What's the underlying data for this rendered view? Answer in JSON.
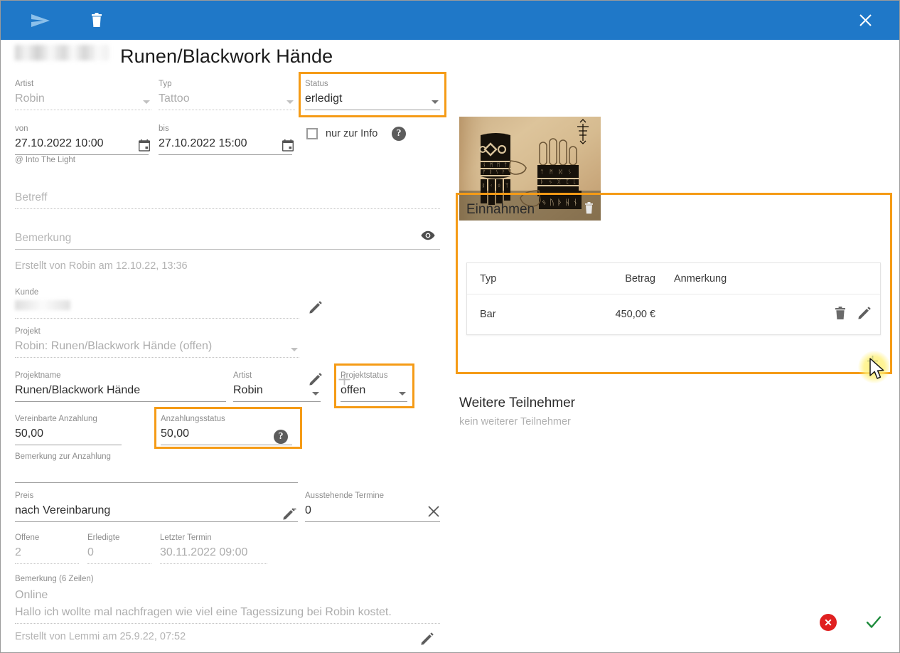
{
  "window": {
    "accent_blue": "#1f78c8",
    "highlight_orange": "#f59b16",
    "toolbar": {
      "send_label": "send-icon",
      "delete_label": "delete-icon",
      "close_label": "×"
    }
  },
  "header": {
    "customer_name_redacted": "",
    "title": "Runen/Blackwork Hände"
  },
  "appointment": {
    "artist": {
      "label": "Artist",
      "value": "Robin"
    },
    "typ": {
      "label": "Typ",
      "value": "Tattoo"
    },
    "status": {
      "label": "Status",
      "value": "erledigt"
    },
    "von": {
      "label": "von",
      "value": "27.10.2022 10:00"
    },
    "bis": {
      "label": "bis",
      "value": "27.10.2022 15:00"
    },
    "info_only": {
      "label": "nur zur Info",
      "checked": false,
      "help": "?"
    },
    "location": "@ Into The Light",
    "betreff": {
      "label": "Betreff",
      "value": ""
    },
    "bemerkung": {
      "label": "Bemerkung",
      "value": ""
    },
    "created": "Erstellt von Robin am 12.10.22, 13:36"
  },
  "customer": {
    "label": "Kunde",
    "value_redacted": ""
  },
  "project_select": {
    "label": "Projekt",
    "value": "Robin: Runen/Blackwork Hände (offen)"
  },
  "project": {
    "name": {
      "label": "Projektname",
      "value": "Runen/Blackwork Hände"
    },
    "artist": {
      "label": "Artist",
      "value": "Robin"
    },
    "status": {
      "label": "Projektstatus",
      "value": "offen"
    },
    "deposit_agreed": {
      "label": "Vereinbarte Anzahlung",
      "value": "50,00"
    },
    "deposit_status": {
      "label": "Anzahlungsstatus",
      "value": "50,00",
      "help": "?"
    },
    "deposit_note": {
      "label": "Bemerkung zur Anzahlung",
      "value": ""
    },
    "price": {
      "label": "Preis",
      "value": "nach Vereinbarung"
    },
    "pending_appointments": {
      "label": "Ausstehende Termine",
      "value": "0"
    },
    "open": {
      "label": "Offene",
      "value": "2"
    },
    "done": {
      "label": "Erledigte",
      "value": "0"
    },
    "last_appointment": {
      "label": "Letzter Termin",
      "value": "30.11.2022 09:00"
    },
    "note": {
      "label": "Bemerkung (6 Zeilen)",
      "line1": "Online",
      "line2": "Hallo ich wollte mal nachfragen wie viel eine Tagessizung bei Robin kostet."
    },
    "created": "Erstellt von Lemmi am 25.9.22, 07:52"
  },
  "income": {
    "title": "Einnahmen",
    "columns": [
      "Typ",
      "Betrag",
      "Anmerkung"
    ],
    "rows": [
      {
        "typ": "Bar",
        "betrag": "450,00 €",
        "anmerkung": ""
      }
    ],
    "add_label": "+"
  },
  "participants": {
    "title": "Weitere Teilnehmer",
    "empty_text": "kein weiterer Teilnehmer"
  },
  "footer": {
    "cancel_label": "×",
    "confirm_label": "✓",
    "cancel_color": "#e02020",
    "confirm_color": "#1e8b3c"
  }
}
